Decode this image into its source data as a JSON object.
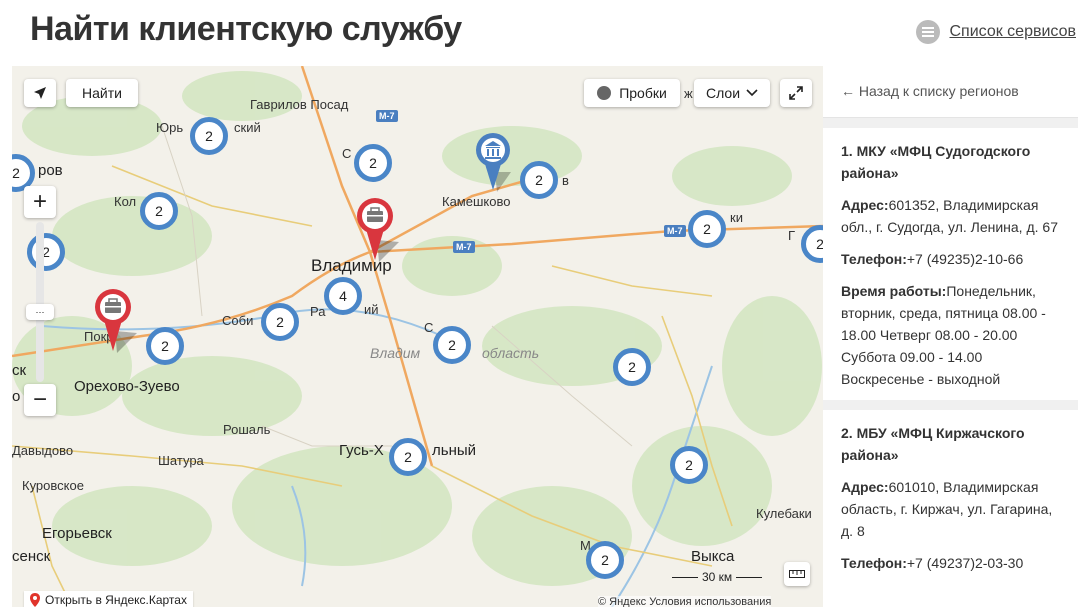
{
  "page": {
    "title": "Найти клиентскую службу",
    "services_link": "Список сервисов"
  },
  "map": {
    "controls": {
      "find_button": "Найти",
      "traffic_button": "Пробки",
      "layers_button": "Слои",
      "zoom_in": "+",
      "zoom_out": "−"
    },
    "clusters": [
      "2",
      "2",
      "2",
      "2",
      "2",
      "2",
      "2",
      "2",
      "2",
      "2",
      "4",
      "2",
      "2",
      "2",
      "2",
      "2",
      "2",
      "2"
    ],
    "labels": {
      "gavrilov_posad": "Гаврилов Посад",
      "yuryev": "Юрь",
      "yuryev_end": "ский",
      "rov": "ров",
      "kol": "Кол",
      "kameshkovo": "Камешково",
      "vladimir": "Владимир",
      "sobi": "Соби",
      "ra": "Ра",
      "ny": "ий",
      "vlad_oblast_a": "Владим",
      "vlad_oblast_b": "область",
      "pokr": "Покр",
      "orekhovo": "Орехово-Зуево",
      "sk": "ск",
      "ob": "о",
      "rosh": "Рошаль",
      "davydovo": "Давыдово",
      "shatura": "Шатура",
      "gus_a": "Гусь-Х",
      "gus_b": "льный",
      "kurovskoe": "Куровское",
      "egorevsk": "Егорьевск",
      "sensk": "сенск",
      "kulebaki": "Кулебаки",
      "vyksa": "Выкса",
      "m7": "М-7",
      "m": "М",
      "ki": "ки",
      "kovrov_g": "Г",
      "k_s": "С",
      "k_v": "в",
      "s_c": "С",
      "m_road": "ж"
    },
    "scale": "30 км",
    "open_in_yandex": "Открыть в Яндекс.Картах",
    "copyright": "© Яндекс Условия использования"
  },
  "sidebar": {
    "back_link": "← Назад к списку регионов",
    "organizations": [
      {
        "title": "1. МКУ «МФЦ Судогодского района»",
        "address_label": "Адрес:",
        "address": "601352, Владимирская обл., г. Судогда, ул. Ленина, д. 67",
        "phone_label": "Телефон:",
        "phone": "+7 (49235)2-10-66",
        "hours_label": "Время работы:",
        "hours": "Понедельник, вторник, среда, пятница 08.00 - 18.00 Четверг 08.00 - 20.00 Суббота 09.00 - 14.00 Воскресенье - выходной"
      },
      {
        "title": "2. МБУ «МФЦ Киржачского района»",
        "address_label": "Адрес:",
        "address": "601010, Владимирская область, г. Киржач, ул. Гагарина, д. 8",
        "phone_label": "Телефон:",
        "phone": "+7 (49237)2-03-30"
      }
    ]
  },
  "colors": {
    "cluster_border": "#4a86c8",
    "pin_red": "#d9363e",
    "pin_blue": "#4a7fc0",
    "road_orange": "#f0a860"
  }
}
